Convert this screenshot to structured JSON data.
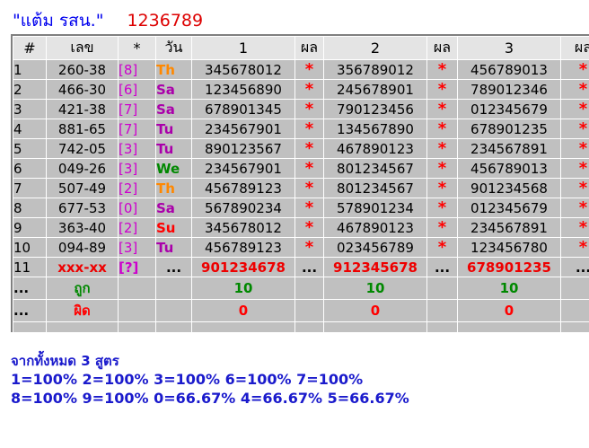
{
  "header": {
    "title": "\"แต้ม รสน.\"",
    "code": "1236789"
  },
  "table": {
    "columns": [
      "#",
      "เลข",
      "*",
      "วัน",
      "1",
      "ผล",
      "2",
      "ผล",
      "3",
      "ผล"
    ],
    "rows": [
      {
        "no": "1",
        "num": "260-38",
        "sym": "[8]",
        "day": "Th",
        "c1": "345678012",
        "r1": "*",
        "c2": "356789012",
        "r2": "*",
        "c3": "456789013",
        "r3": "*"
      },
      {
        "no": "2",
        "num": "466-30",
        "sym": "[6]",
        "day": "Sa",
        "c1": "123456890",
        "r1": "*",
        "c2": "245678901",
        "r2": "*",
        "c3": "789012346",
        "r3": "*"
      },
      {
        "no": "3",
        "num": "421-38",
        "sym": "[7]",
        "day": "Sa",
        "c1": "678901345",
        "r1": "*",
        "c2": "790123456",
        "r2": "*",
        "c3": "012345679",
        "r3": "*"
      },
      {
        "no": "4",
        "num": "881-65",
        "sym": "[7]",
        "day": "Tu",
        "c1": "234567901",
        "r1": "*",
        "c2": "134567890",
        "r2": "*",
        "c3": "678901235",
        "r3": "*"
      },
      {
        "no": "5",
        "num": "742-05",
        "sym": "[3]",
        "day": "Tu",
        "c1": "890123567",
        "r1": "*",
        "c2": "467890123",
        "r2": "*",
        "c3": "234567891",
        "r3": "*"
      },
      {
        "no": "6",
        "num": "049-26",
        "sym": "[3]",
        "day": "We",
        "c1": "234567901",
        "r1": "*",
        "c2": "801234567",
        "r2": "*",
        "c3": "456789013",
        "r3": "*"
      },
      {
        "no": "7",
        "num": "507-49",
        "sym": "[2]",
        "day": "Th",
        "c1": "456789123",
        "r1": "*",
        "c2": "801234567",
        "r2": "*",
        "c3": "901234568",
        "r3": "*"
      },
      {
        "no": "8",
        "num": "677-53",
        "sym": "[0]",
        "day": "Sa",
        "c1": "567890234",
        "r1": "*",
        "c2": "578901234",
        "r2": "*",
        "c3": "012345679",
        "r3": "*"
      },
      {
        "no": "9",
        "num": "363-40",
        "sym": "[2]",
        "day": "Su",
        "c1": "345678012",
        "r1": "*",
        "c2": "467890123",
        "r2": "*",
        "c3": "234567891",
        "r3": "*"
      },
      {
        "no": "10",
        "num": "094-89",
        "sym": "[3]",
        "day": "Tu",
        "c1": "456789123",
        "r1": "*",
        "c2": "023456789",
        "r2": "*",
        "c3": "123456780",
        "r3": "*"
      }
    ],
    "prediction": {
      "no": "11",
      "num": "xxx-xx",
      "sym": "[?]",
      "day": "...",
      "c1": "901234678",
      "r1": "...",
      "c2": "912345678",
      "r2": "...",
      "c3": "678901235",
      "r3": "..."
    },
    "correct_row": {
      "no": "...",
      "label": "ถูก",
      "v1": "10",
      "v2": "10",
      "v3": "10"
    },
    "wrong_row": {
      "no": "...",
      "label": "ผิด",
      "v1": "0",
      "v2": "0",
      "v3": "0"
    }
  },
  "colors": {
    "Th": "#ff8800",
    "Sa": "#aa00aa",
    "Tu": "#aa00aa",
    "We": "#008800",
    "Su": "#ff0000"
  },
  "footer": {
    "subtitle": "จากทั้งหมด 3 สูตร",
    "line1": "1=100% 2=100% 3=100% 6=100% 7=100%",
    "line2": "8=100% 9=100% 0=66.67% 4=66.67% 5=66.67%"
  }
}
